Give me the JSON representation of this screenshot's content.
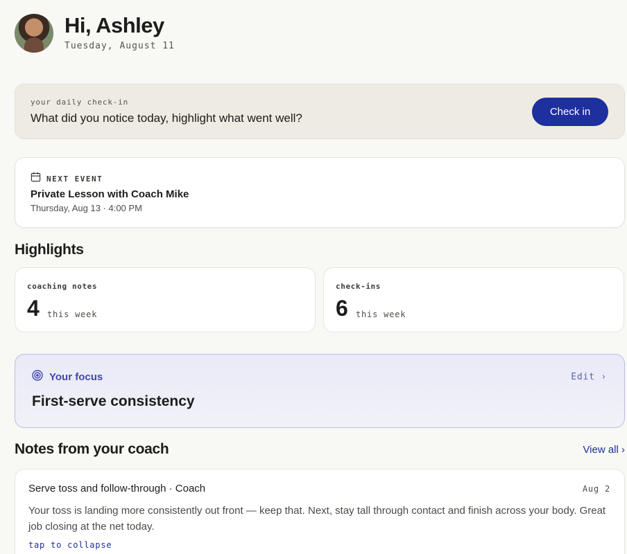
{
  "header": {
    "greeting": "Hi, Ashley",
    "date": "Tuesday, August 11"
  },
  "checkin": {
    "eyebrow": "your daily check-in",
    "question": "What did you notice today, highlight what went well?",
    "button_label": "Check in",
    "button_color": "#1e2f9e"
  },
  "next_event": {
    "label": "NEXT EVENT",
    "title": "Private Lesson with Coach Mike",
    "when": "Thursday, Aug 13 · 4:00 PM",
    "icon": "calendar-icon"
  },
  "highlights": {
    "title": "Highlights",
    "stats": [
      {
        "label": "coaching notes",
        "value": "4",
        "unit": "this week"
      },
      {
        "label": "check-ins",
        "value": "6",
        "unit": "this week"
      }
    ]
  },
  "focus": {
    "label": "Your focus",
    "edit_label": "Edit ›",
    "goal": "First-serve consistency",
    "icon": "target-icon",
    "accent": "#4148a8"
  },
  "notes": {
    "title": "Notes from your coach",
    "view_all": "View all ›",
    "items": [
      {
        "title": "Serve toss and follow-through · Coach",
        "date": "Aug 2",
        "body": "Your toss is landing more consistently out front — keep that. Next, stay tall through contact and finish across your body. Great job closing at the net today.",
        "toggle": "tap to collapse"
      }
    ]
  }
}
